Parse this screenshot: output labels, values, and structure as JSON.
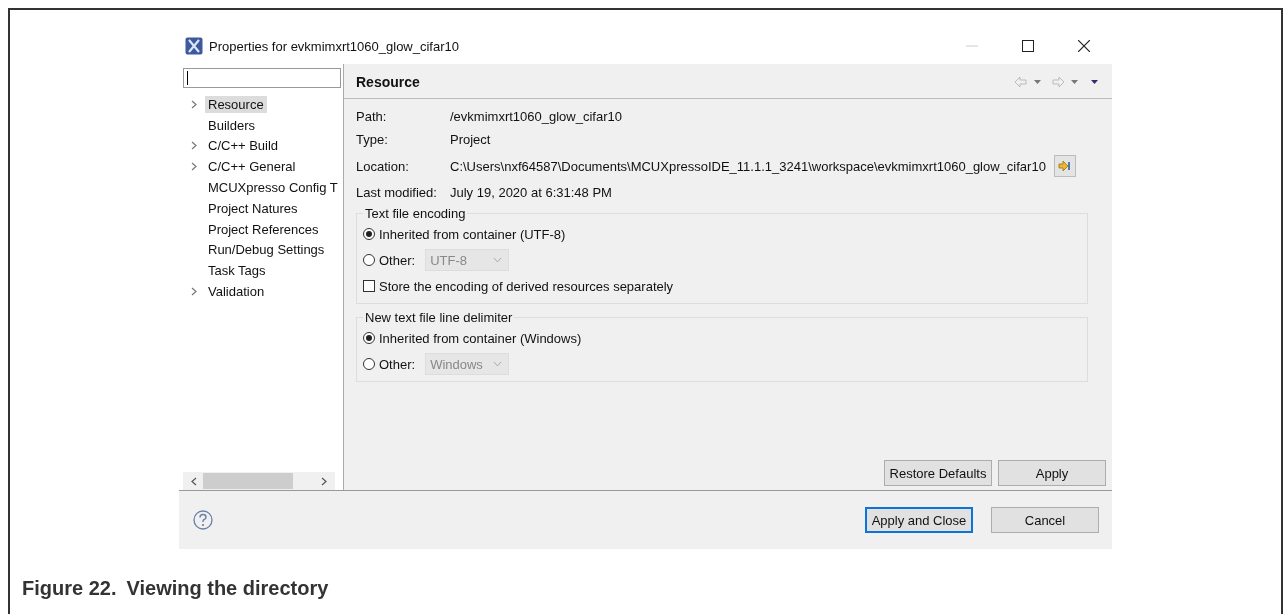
{
  "dialog": {
    "title": "Properties for evkmimxrt1060_glow_cifar10"
  },
  "tree": [
    {
      "label": "Resource",
      "expandable": true,
      "selected": true
    },
    {
      "label": "Builders",
      "expandable": false,
      "selected": false
    },
    {
      "label": "C/C++ Build",
      "expandable": true,
      "selected": false
    },
    {
      "label": "C/C++ General",
      "expandable": true,
      "selected": false
    },
    {
      "label": "MCUXpresso Config T",
      "expandable": false,
      "selected": false
    },
    {
      "label": "Project Natures",
      "expandable": false,
      "selected": false
    },
    {
      "label": "Project References",
      "expandable": false,
      "selected": false
    },
    {
      "label": "Run/Debug Settings",
      "expandable": false,
      "selected": false
    },
    {
      "label": "Task Tags",
      "expandable": false,
      "selected": false
    },
    {
      "label": "Validation",
      "expandable": true,
      "selected": false
    }
  ],
  "page": {
    "title": "Resource",
    "properties": [
      {
        "label": "Path:",
        "value": "/evkmimxrt1060_glow_cifar10",
        "kind": "text"
      },
      {
        "label": "Type:",
        "value": "Project",
        "kind": "text"
      },
      {
        "label": "Location:",
        "value": "C:\\Users\\nxf64587\\Documents\\MCUXpressoIDE_11.1.1_3241\\workspace\\evkmimxrt1060_glow_cifar10",
        "kind": "location"
      },
      {
        "label": "Last modified:",
        "value": "July 19, 2020 at 6:31:48 PM",
        "kind": "text"
      }
    ]
  },
  "groups": [
    {
      "title": "Text file encoding",
      "options": [
        {
          "kind": "radio",
          "label": "Inherited from container (UTF-8)",
          "selected": true
        },
        {
          "kind": "radio-select",
          "label": "Other:",
          "selected": false,
          "select_value": "UTF-8"
        },
        {
          "kind": "checkbox",
          "label": "Store the encoding of derived resources separately",
          "checked": false
        }
      ]
    },
    {
      "title": "New text file line delimiter",
      "options": [
        {
          "kind": "radio",
          "label": "Inherited from container (Windows)",
          "selected": true
        },
        {
          "kind": "radio-select",
          "label": "Other:",
          "selected": false,
          "select_value": "Windows"
        }
      ]
    }
  ],
  "page_buttons": [
    "Restore Defaults",
    "Apply"
  ],
  "dialog_buttons": [
    {
      "label": "Apply and Close",
      "default": true
    },
    {
      "label": "Cancel",
      "default": false
    }
  ],
  "caption": {
    "number": "Figure 22.",
    "title": "Viewing the directory"
  }
}
